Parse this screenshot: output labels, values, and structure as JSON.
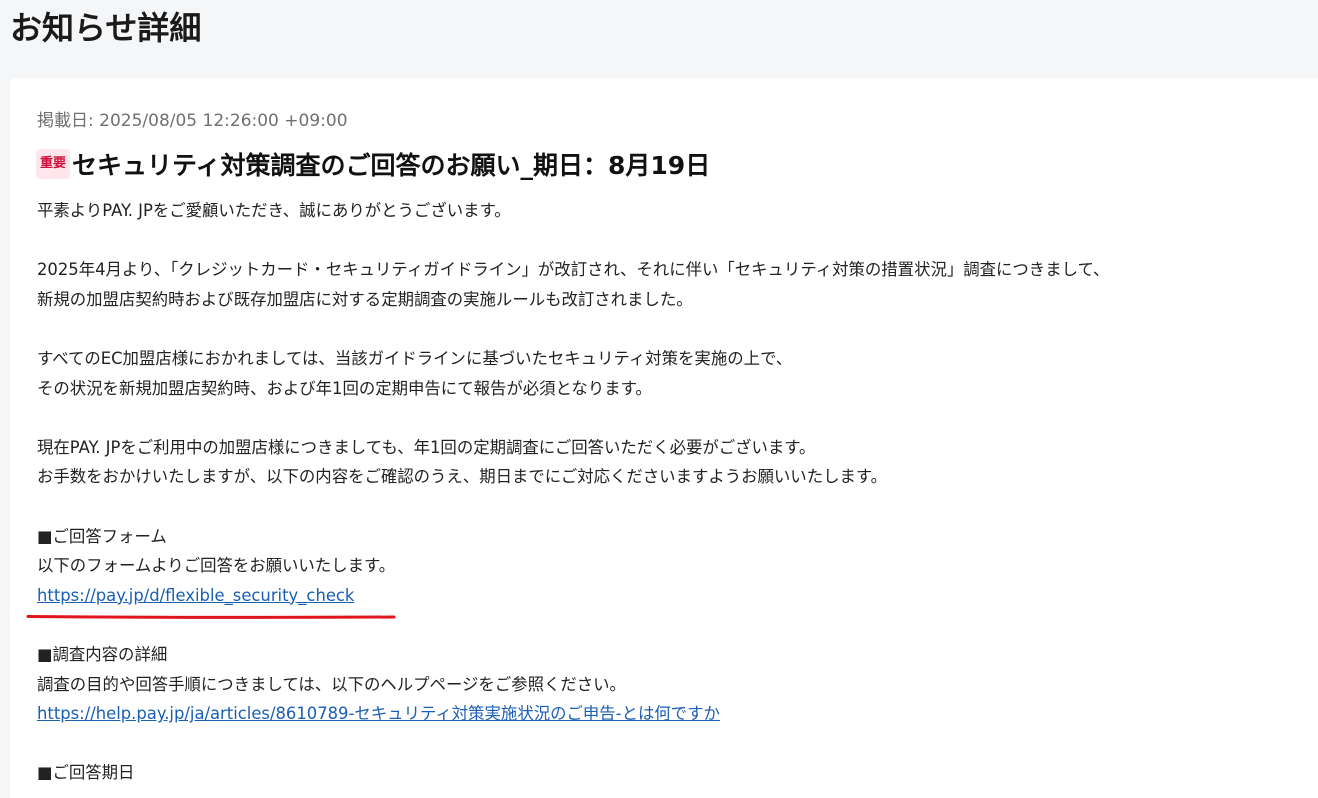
{
  "page": {
    "title": "お知らせ詳細"
  },
  "notice": {
    "posted": "掲載日: 2025/08/05 12:26:00 +09:00",
    "badge": "重要",
    "headline": "セキュリティ対策調査のご回答のお願い_期日：8月19日",
    "p1": "平素よりPAY. JPをご愛顧いただき、誠にありがとうございます。",
    "p2_line1": "2025年4月より、「クレジットカード・セキュリティガイドライン」が改訂され、それに伴い「セキュリティ対策の措置状況」調査につきまして、",
    "p2_line2": "新規の加盟店契約時および既存加盟店に対する定期調査の実施ルールも改訂されました。",
    "p3_line1": "すべてのEC加盟店様におかれましては、当該ガイドラインに基づいたセキュリティ対策を実施の上で、",
    "p3_line2": "その状況を新規加盟店契約時、および年1回の定期申告にて報告が必須となります。",
    "p4_line1": "現在PAY. JPをご利用中の加盟店様につきましても、年1回の定期調査にご回答いただく必要がございます。",
    "p4_line2": "お手数をおかけいたしますが、以下の内容をご確認のうえ、期日までにご対応くださいますようお願いいたします。",
    "section_form": {
      "heading": "■ご回答フォーム",
      "text": "以下のフォームよりご回答をお願いいたします。",
      "link": "https://pay.jp/d/flexible_security_check"
    },
    "section_details": {
      "heading": "■調査内容の詳細",
      "text": "調査の目的や回答手順につきましては、以下のヘルプページをご参照ください。",
      "link": "https://help.pay.jp/ja/articles/8610789-セキュリティ対策実施状況のご申告-とは何ですか"
    },
    "section_deadline": {
      "heading": "■ご回答期日"
    }
  },
  "colors": {
    "link": "#1a5fb4",
    "badge_bg": "#fde7ec",
    "badge_text": "#d0103a",
    "annotation_underline": "#e0161e"
  }
}
